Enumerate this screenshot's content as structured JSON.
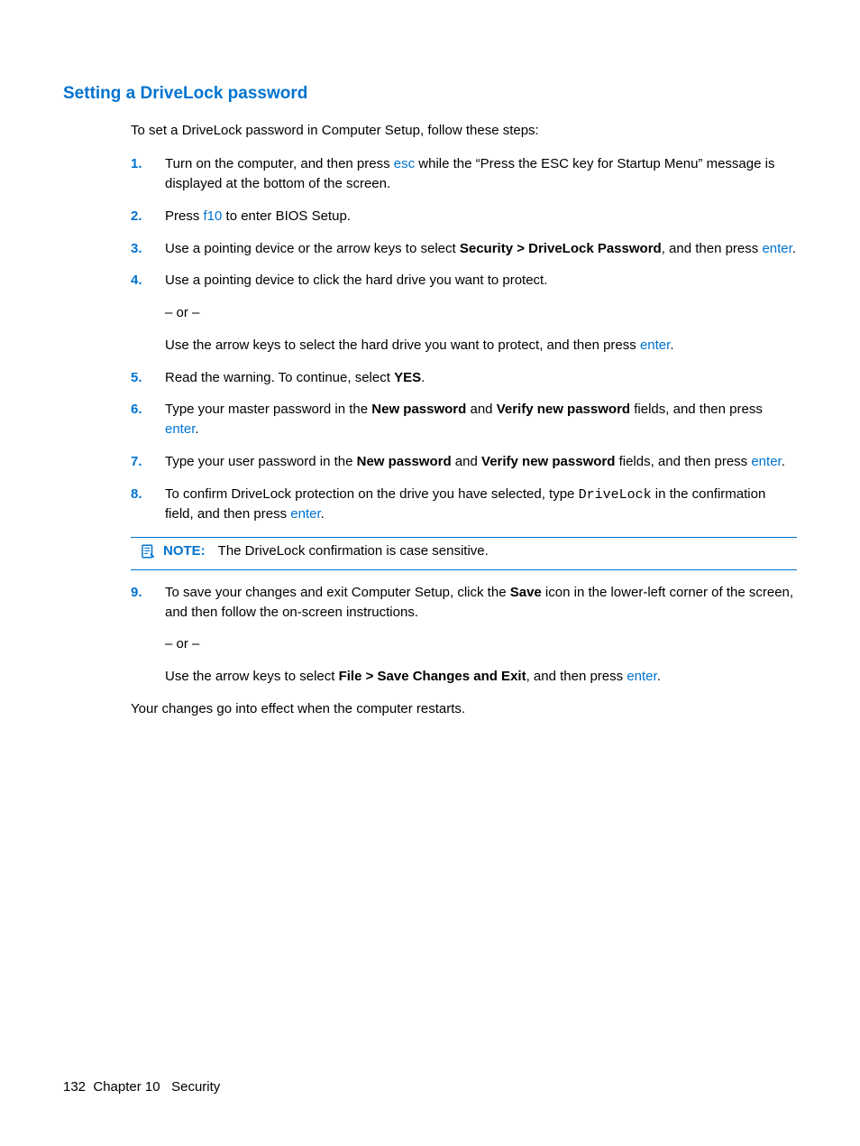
{
  "heading": "Setting a DriveLock password",
  "intro": "To set a DriveLock password in Computer Setup, follow these steps:",
  "steps": {
    "n1": "1.",
    "s1a": "Turn on the computer, and then press ",
    "s1key": "esc",
    "s1b": " while the “Press the ESC key for Startup Menu” message is displayed at the bottom of the screen.",
    "n2": "2.",
    "s2a": "Press ",
    "s2key": "f10",
    "s2b": " to enter BIOS Setup.",
    "n3": "3.",
    "s3a": "Use a pointing device or the arrow keys to select ",
    "s3bold": "Security > DriveLock Password",
    "s3b": ", and then press ",
    "s3key": "enter",
    "s3c": ".",
    "n4": "4.",
    "s4a": "Use a pointing device to click the hard drive you want to protect.",
    "s4or": "– or –",
    "s4b": "Use the arrow keys to select the hard drive you want to protect, and then press ",
    "s4key": "enter",
    "s4c": ".",
    "n5": "5.",
    "s5a": "Read the warning. To continue, select ",
    "s5bold": "YES",
    "s5b": ".",
    "n6": "6.",
    "s6a": "Type your master password in the ",
    "s6bold1": "New password",
    "s6b": " and ",
    "s6bold2": "Verify new password",
    "s6c": " fields, and then press ",
    "s6key": "enter",
    "s6d": ".",
    "n7": "7.",
    "s7a": "Type your user password in the ",
    "s7bold1": "New password",
    "s7b": " and ",
    "s7bold2": "Verify new password",
    "s7c": " fields, and then press ",
    "s7key": "enter",
    "s7d": ".",
    "n8": "8.",
    "s8a": "To confirm DriveLock protection on the drive you have selected, type ",
    "s8code": "DriveLock",
    "s8b": " in the confirmation field, and then press ",
    "s8key": "enter",
    "s8c": ".",
    "n9": "9.",
    "s9a": "To save your changes and exit Computer Setup, click the ",
    "s9bold1": "Save",
    "s9b": " icon in the lower-left corner of the screen, and then follow the on-screen instructions.",
    "s9or": "– or –",
    "s9c": "Use the arrow keys to select ",
    "s9bold2": "File > Save Changes and Exit",
    "s9d": ", and then press ",
    "s9key": "enter",
    "s9e": "."
  },
  "note": {
    "label": "NOTE:",
    "text": "The DriveLock confirmation is case sensitive."
  },
  "closing": "Your changes go into effect when the computer restarts.",
  "footer": {
    "page": "132",
    "chapter": "Chapter 10   Security"
  }
}
